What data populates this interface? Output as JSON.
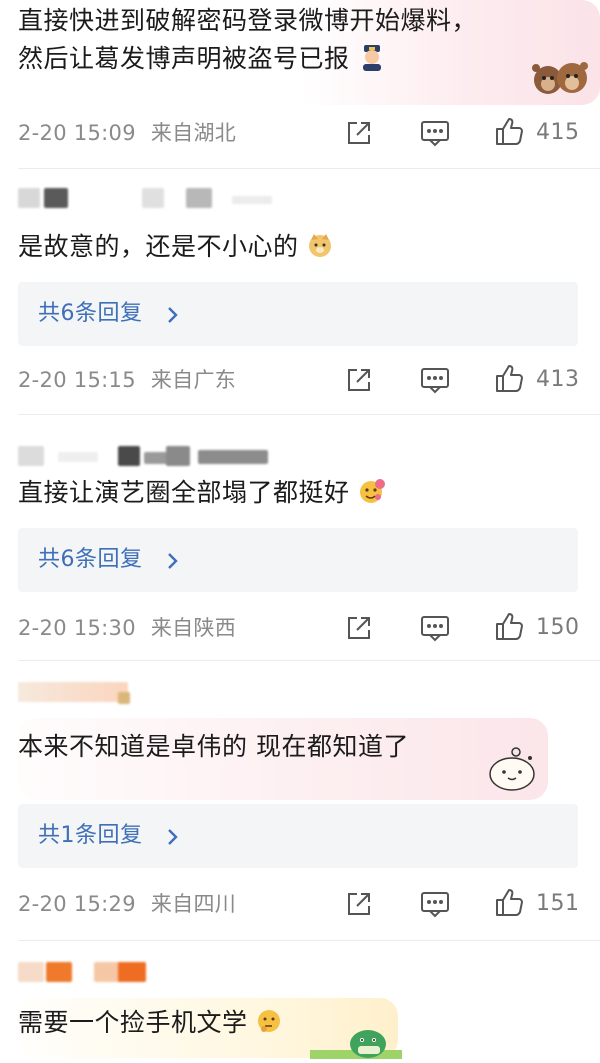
{
  "comments": [
    {
      "text_line1": "直接快进到破解密码登录微博开始爆料，",
      "text_line2": "然后让葛发博声明被盗号已报",
      "date": "2-20 15:09",
      "location": "来自湖北",
      "likes": "415"
    },
    {
      "text": "是故意的，还是不小心的",
      "reply": "共6条回复",
      "date": "2-20 15:15",
      "location": "来自广东",
      "likes": "413"
    },
    {
      "text": "直接让演艺圈全部塌了都挺好",
      "reply": "共6条回复",
      "date": "2-20 15:30",
      "location": "来自陕西",
      "likes": "150"
    },
    {
      "text": "本来不知道是卓伟的 现在都知道了",
      "reply": "共1条回复",
      "date": "2-20 15:29",
      "location": "来自四川",
      "likes": "151"
    },
    {
      "text": "需要一个捡手机文学"
    }
  ],
  "icons": {
    "share": "share-icon",
    "comment": "comment-icon",
    "like": "thumbs-up-icon",
    "chevron": "chevron-right-icon"
  },
  "colors": {
    "reply_link": "#3e6fb8",
    "meta_gray": "#8a8a8a",
    "reply_bg": "#f4f5f7"
  }
}
